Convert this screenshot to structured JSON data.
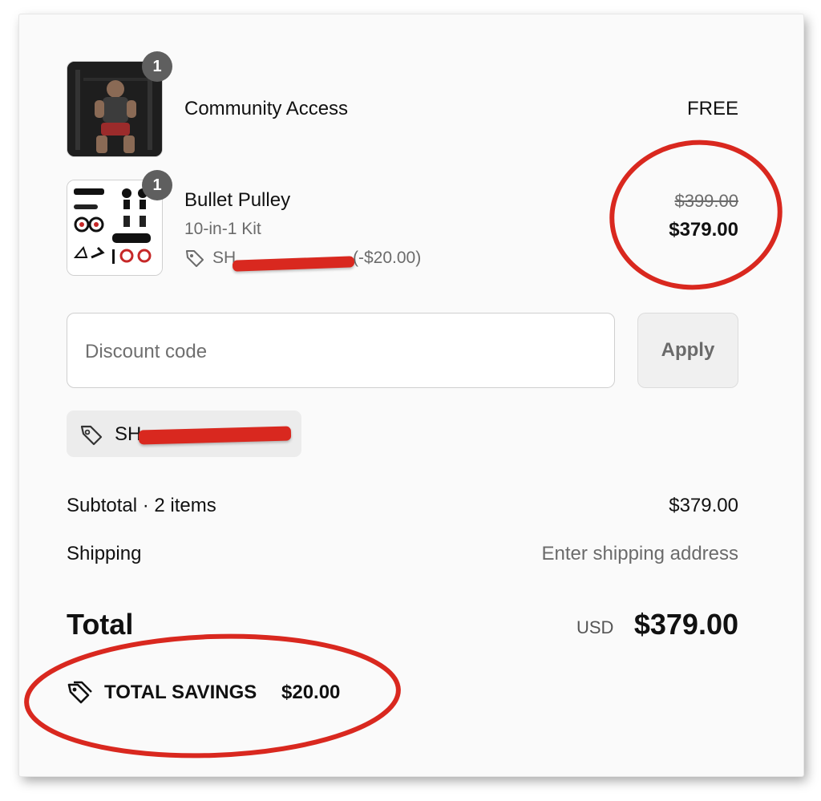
{
  "items": [
    {
      "quantity": "1",
      "name": "Community Access",
      "price": "FREE",
      "image": "athlete-photo"
    },
    {
      "quantity": "1",
      "name": "Bullet Pulley",
      "variant": "10-in-1 Kit",
      "discount_code_prefix": "SH",
      "discount_amount": "(-$20.00)",
      "original_price": "$399.00",
      "price": "$379.00",
      "image": "kit-product-photo"
    }
  ],
  "discount": {
    "placeholder": "Discount code",
    "apply_label": "Apply",
    "applied_code_prefix": "SH"
  },
  "summary": {
    "subtotal_label": "Subtotal · 2 items",
    "subtotal_value": "$379.00",
    "shipping_label": "Shipping",
    "shipping_value": "Enter shipping address",
    "total_label": "Total",
    "currency": "USD",
    "total_value": "$379.00",
    "savings_label": "TOTAL SAVINGS",
    "savings_value": "$20.00"
  },
  "colors": {
    "annotation_red": "#d9281f",
    "badge_gray": "#5f5f5f"
  }
}
